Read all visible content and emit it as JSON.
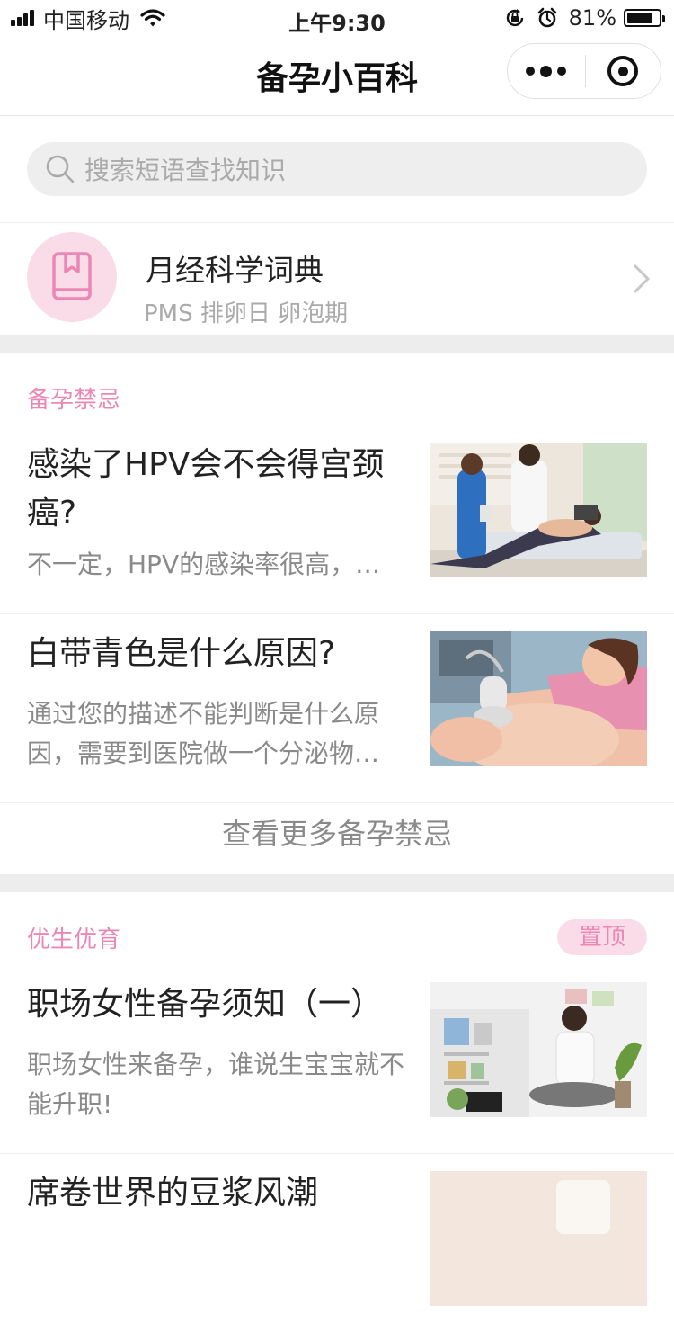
{
  "status_bar": {
    "carrier": "中国移动",
    "time": "上午9:30",
    "battery_pct": "81%",
    "battery_level": 0.81
  },
  "nav": {
    "title": "备孕小百科"
  },
  "search": {
    "placeholder": "搜索短语查找知识"
  },
  "dictionary": {
    "title": "月经科学词典",
    "subtitle": "PMS 排卵日 卵泡期"
  },
  "sections": [
    {
      "label": "备孕禁忌",
      "articles": [
        {
          "title": "感染了HPV会不会得宫颈癌?",
          "desc": "不一定，HPV的感染率很高，…"
        },
        {
          "title": "白带青色是什么原因?",
          "desc": "通过您的描述不能判断是什么原因，需要到医院做一个分泌物…"
        }
      ],
      "more_label": "查看更多备孕禁忌"
    },
    {
      "label": "优生优育",
      "badge": "置顶",
      "articles": [
        {
          "title": "职场女性备孕须知（一）",
          "desc": "职场女性来备孕，谁说生宝宝就不能升职!"
        },
        {
          "title": "席卷世界的豆浆风潮",
          "desc": ""
        }
      ]
    }
  ],
  "colors": {
    "accent_pink": "#ec87b5",
    "badge_bg": "#fadbe8",
    "divider": "#ededed"
  }
}
